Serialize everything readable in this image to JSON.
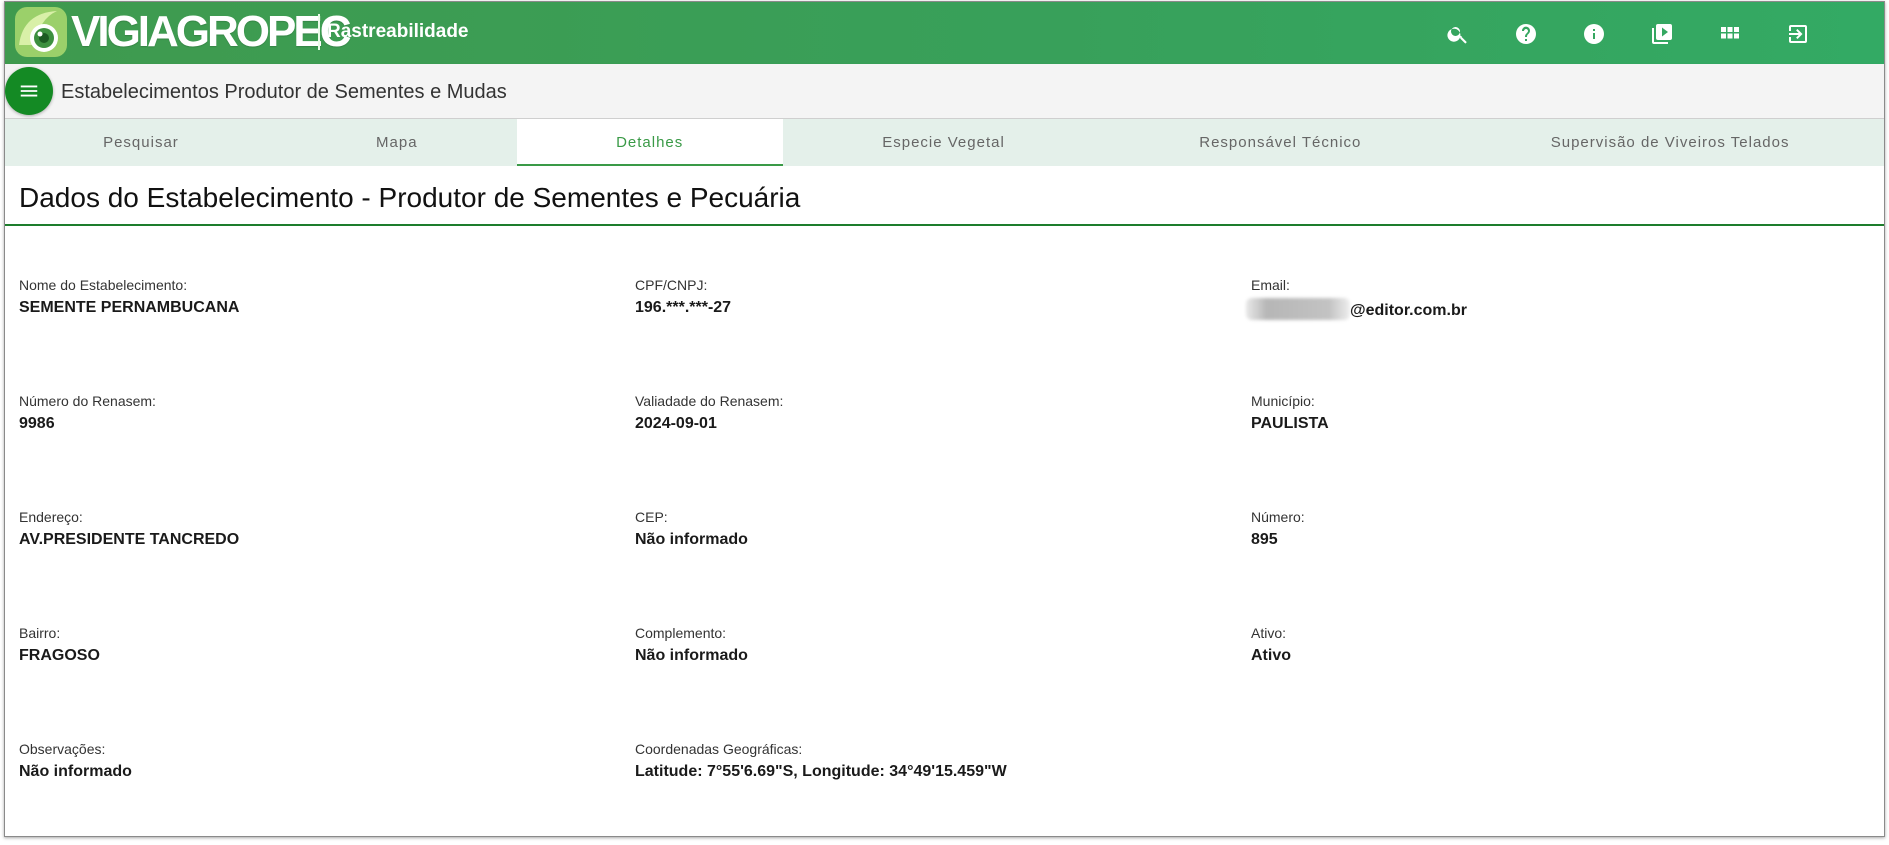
{
  "header": {
    "logo_text": "VIGIAGROPEC",
    "logo_sub": "Rastreabilidade",
    "icons": [
      "search-icon",
      "help-icon",
      "info-icon",
      "video-library-icon",
      "apps-grid-icon",
      "logout-icon"
    ]
  },
  "titlebar": {
    "menu_icon": "menu-icon",
    "title": "Estabelecimentos Produtor de Sementes e Mudas"
  },
  "tabs": [
    {
      "label": "Pesquisar",
      "active": false
    },
    {
      "label": "Mapa",
      "active": false
    },
    {
      "label": "Detalhes",
      "active": true
    },
    {
      "label": "Especie Vegetal",
      "active": false
    },
    {
      "label": "Responsável Técnico",
      "active": false
    },
    {
      "label": "Supervisão de Viveiros Telados",
      "active": false
    }
  ],
  "section": {
    "title": "Dados do Estabelecimento - Produtor de Sementes e Pecuária"
  },
  "fields": {
    "nome": {
      "label": "Nome do Estabelecimento:",
      "value": "SEMENTE PERNAMBUCANA"
    },
    "cpf": {
      "label": "CPF/CNPJ:",
      "value": "196.***.***-27"
    },
    "email": {
      "label": "Email:",
      "value": "@editor.com.br"
    },
    "renasem": {
      "label": "Número do Renasem:",
      "value": "9986"
    },
    "validade": {
      "label": "Valiadade do Renasem:",
      "value": "2024-09-01"
    },
    "municipio": {
      "label": "Município:",
      "value": "PAULISTA"
    },
    "endereco": {
      "label": "Endereço:",
      "value": "AV.PRESIDENTE TANCREDO"
    },
    "cep": {
      "label": "CEP:",
      "value": "Não informado"
    },
    "numero": {
      "label": "Número:",
      "value": "895"
    },
    "bairro": {
      "label": "Bairro:",
      "value": "FRAGOSO"
    },
    "complemento": {
      "label": "Complemento:",
      "value": "Não informado"
    },
    "ativo": {
      "label": "Ativo:",
      "value": "Ativo"
    },
    "observacoes": {
      "label": "Observações:",
      "value": "Não informado"
    },
    "coordenadas": {
      "label": "Coordenadas Geográficas:",
      "value": "Latitude: 7°55'6.69\"S, Longitude: 34°49'15.459\"W"
    }
  },
  "colors": {
    "header_green": "#3f9a4e",
    "menu_button": "#148a24",
    "active_tab": "#3a9a47",
    "tabs_background": "#e4f0ea",
    "section_rule": "#1d7d2c"
  }
}
